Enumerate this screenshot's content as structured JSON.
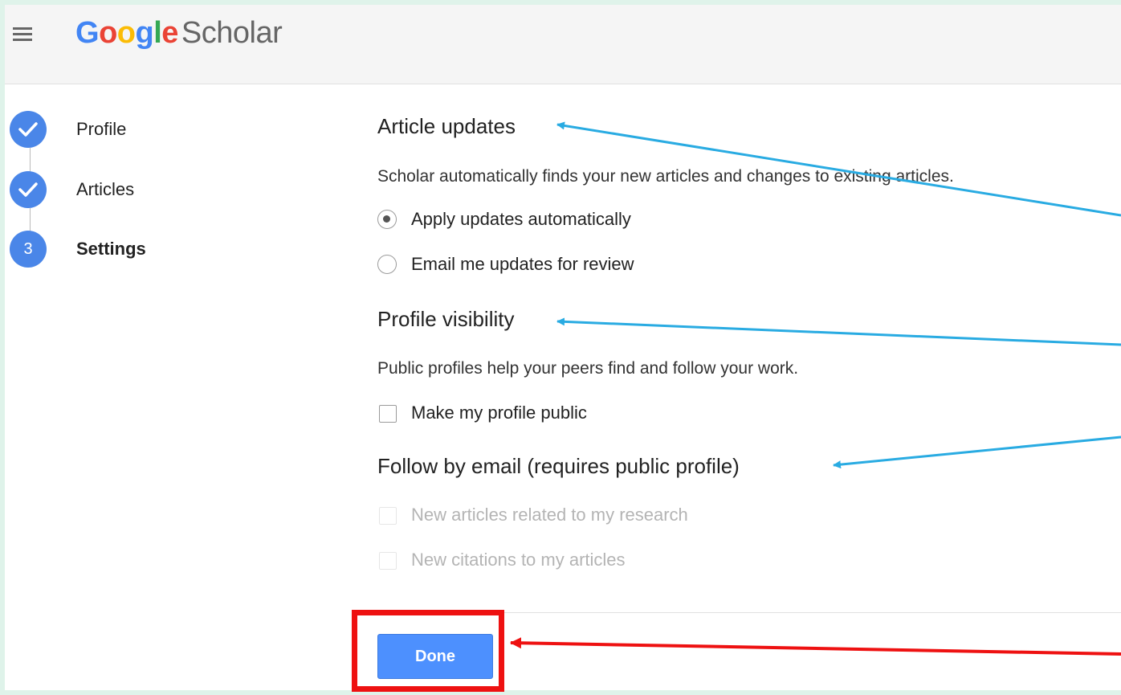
{
  "header": {
    "logo_google": [
      "G",
      "o",
      "o",
      "g",
      "l",
      "e"
    ],
    "logo_google_colors": [
      "#4285f4",
      "#ea4335",
      "#fbbc05",
      "#4285f4",
      "#34a853",
      "#ea4335"
    ],
    "logo_scholar": "Scholar"
  },
  "steps": [
    {
      "marker": "check",
      "label": "Profile"
    },
    {
      "marker": "check",
      "label": "Articles"
    },
    {
      "marker": "3",
      "label": "Settings"
    }
  ],
  "article_updates": {
    "heading": "Article updates",
    "description": "Scholar automatically finds your new articles and changes to existing articles.",
    "options": [
      {
        "label": "Apply updates automatically",
        "selected": true
      },
      {
        "label": "Email me updates for review",
        "selected": false
      }
    ]
  },
  "profile_visibility": {
    "heading": "Profile visibility",
    "description": "Public profiles help your peers find and follow your work.",
    "checkbox_label": "Make my profile public",
    "checked": false
  },
  "follow_by_email": {
    "heading": "Follow by email (requires public profile)",
    "options": [
      {
        "label": "New articles related to my research",
        "disabled": true
      },
      {
        "label": "New citations to my articles",
        "disabled": true
      }
    ]
  },
  "footer": {
    "done_label": "Done"
  },
  "annotation_colors": {
    "blue": "#29abe2",
    "red": "#ee1111"
  }
}
